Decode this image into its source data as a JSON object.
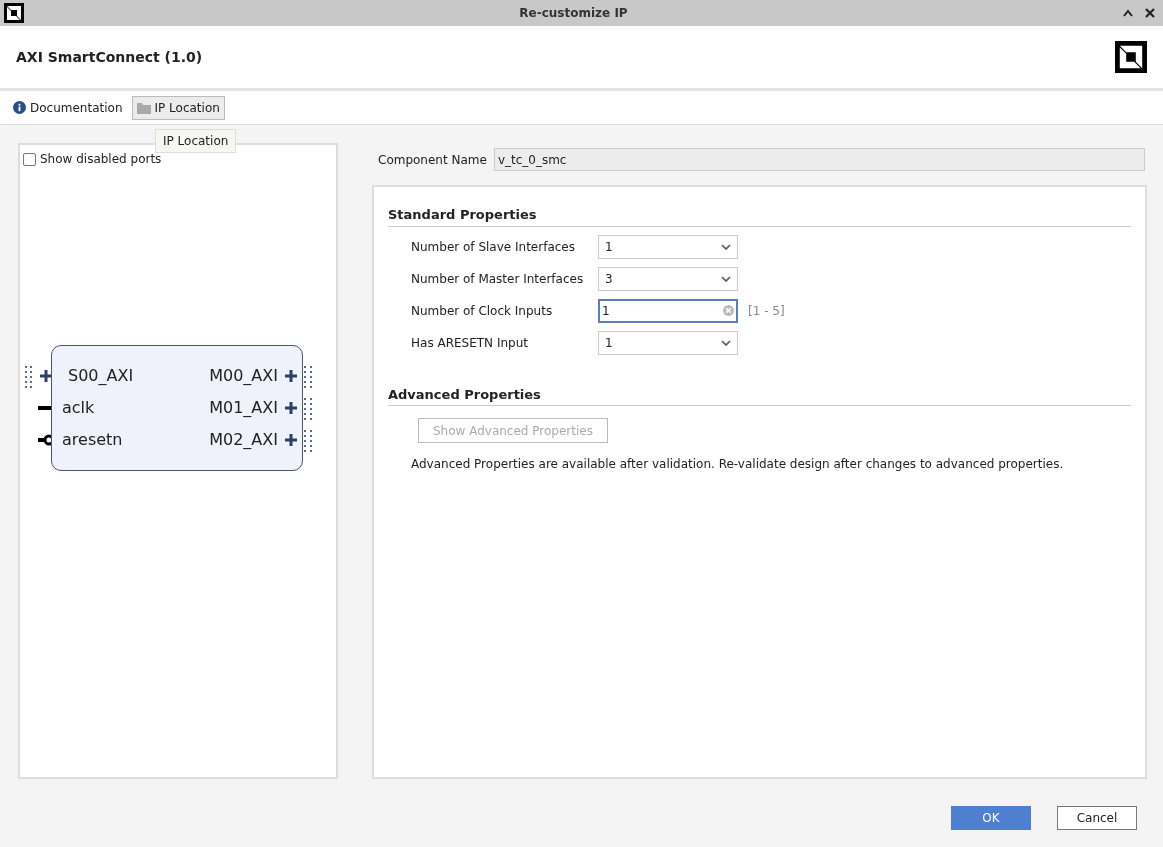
{
  "window": {
    "title": "Re-customize IP"
  },
  "header": {
    "title": "AXI SmartConnect (1.0)"
  },
  "tabs": [
    {
      "label": "Documentation",
      "kind": "info",
      "selected": false
    },
    {
      "label": "IP Location",
      "kind": "folder",
      "selected": true
    }
  ],
  "tooltip": "IP Location",
  "left_panel": {
    "show_disabled_ports": {
      "label": "Show disabled ports",
      "checked": false
    },
    "block": {
      "left_ports": [
        {
          "label": "S00_AXI",
          "kind": "bus"
        },
        {
          "label": "aclk",
          "kind": "clock"
        },
        {
          "label": "aresetn",
          "kind": "reset"
        }
      ],
      "right_ports": [
        {
          "label": "M00_AXI",
          "kind": "bus"
        },
        {
          "label": "M01_AXI",
          "kind": "bus"
        },
        {
          "label": "M02_AXI",
          "kind": "bus"
        }
      ]
    }
  },
  "component_name": {
    "label": "Component Name",
    "value": "v_tc_0_smc"
  },
  "standard_properties": {
    "title": "Standard Properties",
    "fields": [
      {
        "label": "Number of Slave Interfaces",
        "kind": "dropdown",
        "value": "1"
      },
      {
        "label": "Number of Master Interfaces",
        "kind": "dropdown",
        "value": "3"
      },
      {
        "label": "Number of Clock Inputs",
        "kind": "text",
        "value": "1",
        "range": "[1 - 5]"
      },
      {
        "label": "Has ARESETN Input",
        "kind": "dropdown",
        "value": "1"
      }
    ]
  },
  "advanced_properties": {
    "title": "Advanced Properties",
    "button": {
      "label": "Show Advanced Properties",
      "disabled": true
    },
    "note": "Advanced Properties are available after validation. Re-validate design after changes to advanced properties."
  },
  "buttons": [
    {
      "label": "OK",
      "kind": "primary"
    },
    {
      "label": "Cancel",
      "kind": "secondary"
    }
  ]
}
